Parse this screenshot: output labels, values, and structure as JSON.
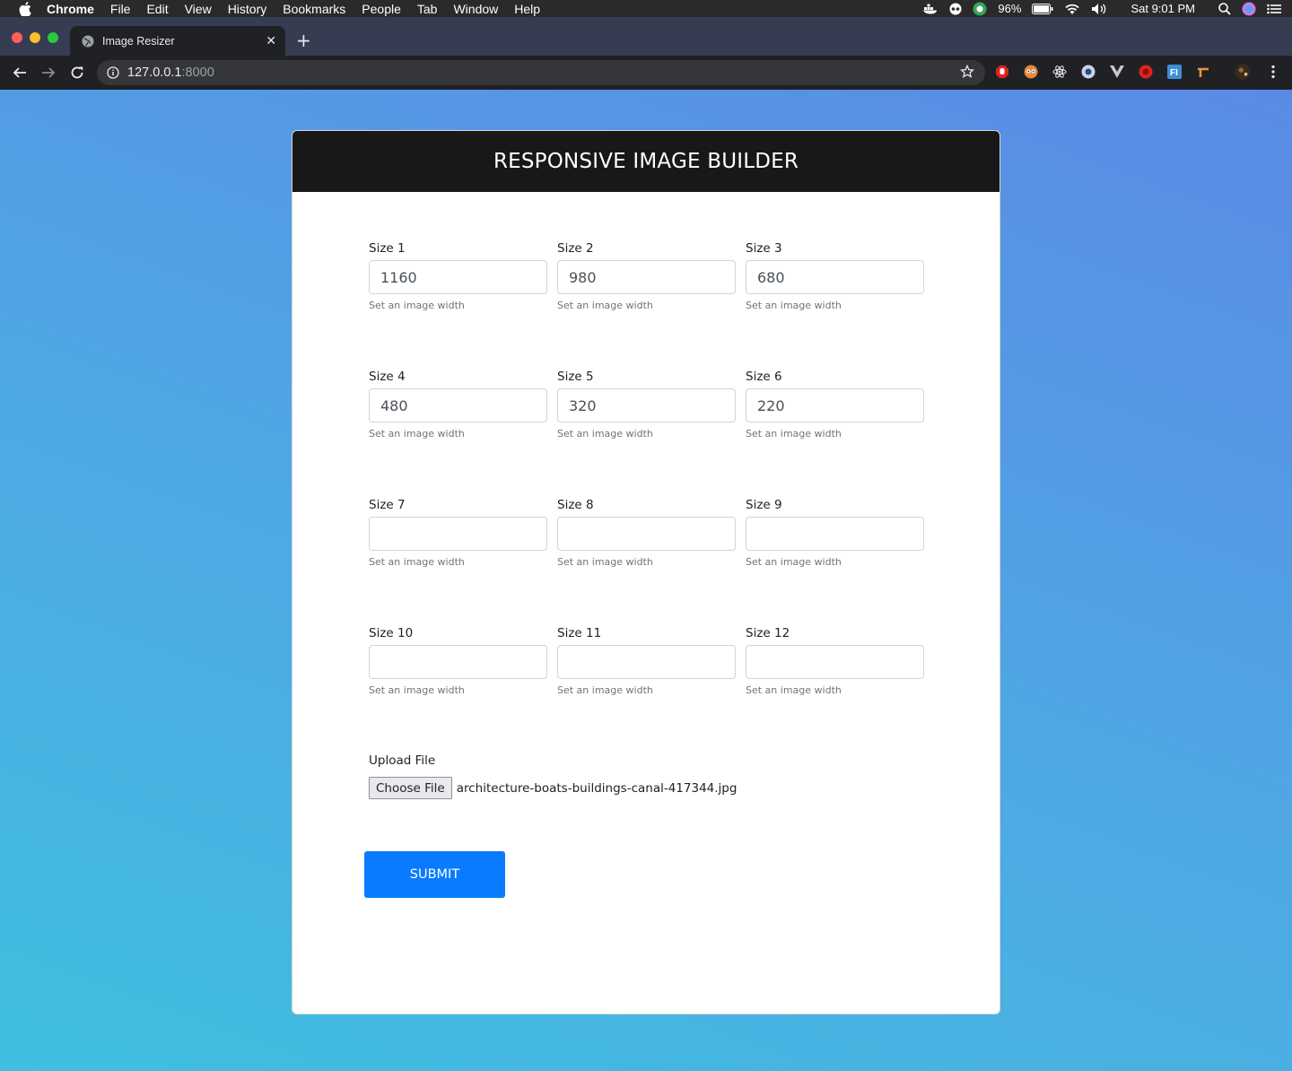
{
  "menubar": {
    "items": [
      "Chrome",
      "File",
      "Edit",
      "View",
      "History",
      "Bookmarks",
      "People",
      "Tab",
      "Window",
      "Help"
    ],
    "battery": "96%",
    "clock": "Sat 9:01 PM"
  },
  "browser": {
    "tab_title": "Image Resizer",
    "url_host": "127.0.0.1",
    "url_port": ":8000"
  },
  "form": {
    "title": "RESPONSIVE IMAGE BUILDER",
    "hint": "Set an image width",
    "fields": [
      {
        "label": "Size 1",
        "value": "1160"
      },
      {
        "label": "Size 2",
        "value": "980"
      },
      {
        "label": "Size 3",
        "value": "680"
      },
      {
        "label": "Size 4",
        "value": "480"
      },
      {
        "label": "Size 5",
        "value": "320"
      },
      {
        "label": "Size 6",
        "value": "220"
      },
      {
        "label": "Size 7",
        "value": ""
      },
      {
        "label": "Size 8",
        "value": ""
      },
      {
        "label": "Size 9",
        "value": ""
      },
      {
        "label": "Size 10",
        "value": ""
      },
      {
        "label": "Size 11",
        "value": ""
      },
      {
        "label": "Size 12",
        "value": ""
      }
    ],
    "upload_label": "Upload File",
    "choose_label": "Choose File",
    "file_name": "architecture-boats-buildings-canal-417344.jpg",
    "submit_label": "SUBMIT"
  },
  "colors": {
    "header_bg": "#181818",
    "submit_bg": "#0a7bff",
    "page_gradient_start": "#3fbfe0",
    "page_gradient_end": "#5a8ae6"
  }
}
